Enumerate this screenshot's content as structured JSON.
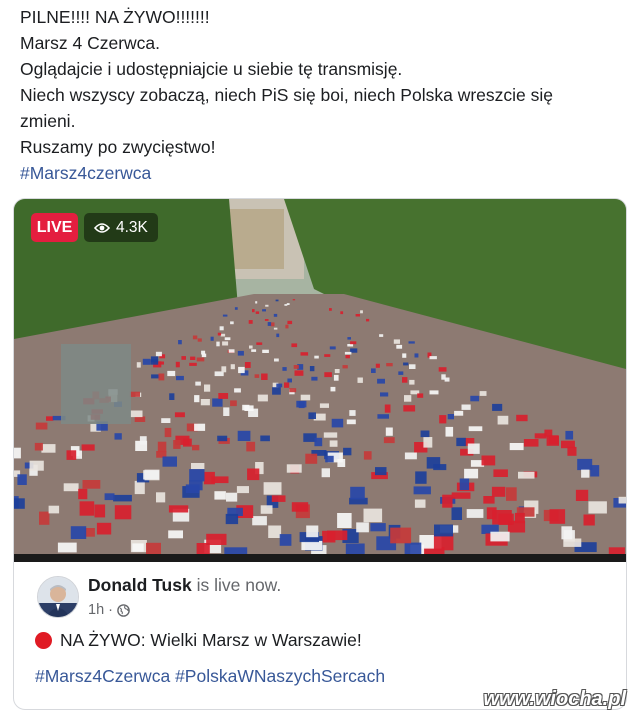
{
  "post": {
    "line1": "PILNE!!!! NA ŻYWO!!!!!!!",
    "line2": "Marsz 4 Czerwca.",
    "line3": "Oglądajcie i udostępniajcie u siebie tę transmisję.",
    "line4": "Niech wszyscy zobaczą, niech PiS się boi, niech Polska wreszcie się",
    "line5": "zmieni.",
    "line6": "Ruszamy po zwycięstwo!",
    "hashtag": "#Marsz4czerwca"
  },
  "video": {
    "live_label": "LIVE",
    "viewers": "4.3K",
    "eye_icon": "eye-icon",
    "colors": {
      "live": "#e41e3f",
      "trees": "#4f7a34",
      "flag_red": "#d8202e",
      "flag_blue": "#1d3f9a"
    }
  },
  "broadcast": {
    "name": "Donald Tusk",
    "status": "is live now.",
    "time": "1h",
    "globe_icon": "globe-icon",
    "caption": "NA ŻYWO: Wielki Marsz w Warszawie!",
    "tag1": "#Marsz4Czerwca",
    "tag2": "#PolskaWNaszychSercach"
  },
  "watermark": "www.wiocha.pl",
  "colors": {
    "link": "#385898",
    "muted": "#65676b"
  }
}
